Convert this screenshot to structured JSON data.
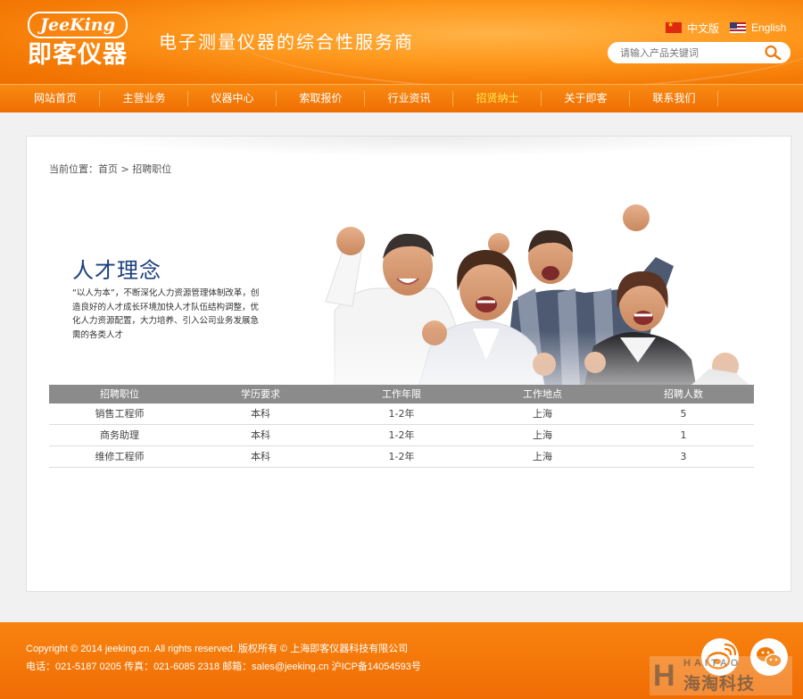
{
  "header": {
    "logo_en": "JeeKing",
    "logo_cn": "即客仪器",
    "slogan": "电子测量仪器的综合性服务商",
    "lang_cn": "中文版",
    "lang_en": "English",
    "search_placeholder": "请输入产品关键词"
  },
  "nav": {
    "items": [
      {
        "label": "网站首页"
      },
      {
        "label": "主营业务"
      },
      {
        "label": "仪器中心"
      },
      {
        "label": "索取报价"
      },
      {
        "label": "行业资讯"
      },
      {
        "label": "招贤纳士"
      },
      {
        "label": "关于即客"
      },
      {
        "label": "联系我们"
      }
    ],
    "active_index": 5
  },
  "breadcrumb": {
    "prefix": "当前位置：",
    "home": "首页",
    "sep": ">",
    "current": "招聘职位"
  },
  "banner": {
    "title": "人才理念",
    "text": "“以人为本”，不断深化人力资源管理体制改革，创造良好的人才成长环境加快人才队伍结构调整，优化人力资源配置，大力培养、引入公司业务发展急需的各类人才"
  },
  "table": {
    "headers": [
      "招聘职位",
      "学历要求",
      "工作年限",
      "工作地点",
      "招聘人数"
    ],
    "rows": [
      [
        "销售工程师",
        "本科",
        "1-2年",
        "上海",
        "5"
      ],
      [
        "商务助理",
        "本科",
        "1-2年",
        "上海",
        "1"
      ],
      [
        "维修工程师",
        "本科",
        "1-2年",
        "上海",
        "3"
      ]
    ]
  },
  "footer": {
    "line1": "Copyright © 2014 jeeking.cn. All rights reserved.  版权所有 © 上海即客仪器科技有限公司",
    "line2": "电话：021-5187 0205  传真：021-6085 2318  邮箱：sales@jeeking.cn  沪ICP备14054593号"
  },
  "watermark": {
    "letter": "H",
    "en": "HAITAO",
    "cn": "海淘科技"
  },
  "colors": {
    "brand_orange": "#f47a06",
    "nav_active": "#ffea4d",
    "title_blue": "#1a3f7d",
    "table_header": "#8b8b8b"
  }
}
